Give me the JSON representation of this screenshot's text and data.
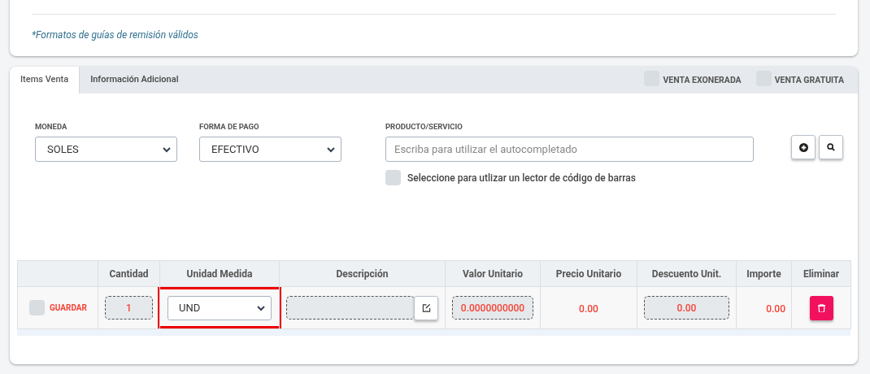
{
  "top_card": {
    "note": "*Formatos de guías de remisión válidos"
  },
  "tabs": [
    {
      "label": "Items Venta",
      "selected": true
    },
    {
      "label": "Información Adicional",
      "selected": false
    }
  ],
  "tab_options": [
    {
      "label": "VENTA EXONERADA",
      "checked": false
    },
    {
      "label": "VENTA GRATUITA",
      "checked": false
    }
  ],
  "form": {
    "moneda": {
      "label": "MONEDA",
      "value": "SOLES"
    },
    "forma_pago": {
      "label": "FORMA DE PAGO",
      "value": "EFECTIVO"
    },
    "producto": {
      "label": "PRODUCTO/SERVICIO",
      "placeholder": "Escriba para utilizar el autocompletado"
    },
    "barcode": {
      "label": "Seleccione para utlizar un lector de código de barras",
      "checked": false
    }
  },
  "table": {
    "columns": [
      "",
      "Cantidad",
      "Unidad Medida",
      "Descripción",
      "Valor Unitario",
      "Precio Unitario",
      "Descuento Unit.",
      "Importe",
      "Eliminar"
    ],
    "rows": [
      {
        "checked": false,
        "save_label": "GUARDAR",
        "cantidad": "1",
        "unidad": "UND",
        "unidad_highlighted": true,
        "descripcion": "",
        "valor_unitario": "0.0000000000",
        "precio_unitario": "0.00",
        "descuento": "0.00",
        "importe": "0.00"
      }
    ]
  }
}
